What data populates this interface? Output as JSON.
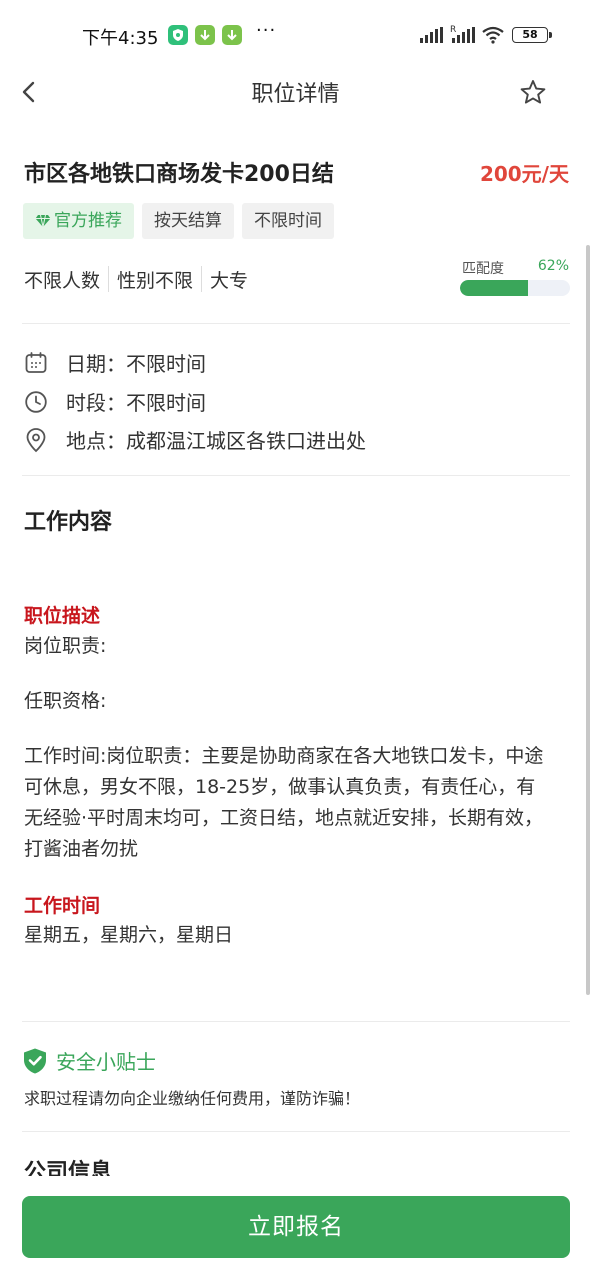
{
  "status_bar": {
    "time": "下午4:35",
    "dots": "···",
    "battery": "58"
  },
  "nav": {
    "title": "职位详情"
  },
  "job": {
    "title": "市区各地铁口商场发卡200日结",
    "salary": "200元/天",
    "tags": [
      "官方推荐",
      "按天结算",
      "不限时间"
    ],
    "attributes": [
      "不限人数",
      "性别不限",
      "大专"
    ],
    "match": {
      "label": "匹配度",
      "value_text": "62%",
      "value": 0.62
    }
  },
  "info": {
    "date": "日期：不限时间",
    "period": "时段：不限时间",
    "location": "地点：成都温江城区各铁口进出处"
  },
  "work_content": {
    "title": "工作内容",
    "desc_title": "职位描述",
    "duties": "岗位职责:",
    "qualifications": "任职资格:",
    "worktime_para": "工作时间:岗位职责：主要是协助商家在各大地铁口发卡，中途可休息，男女不限，18-25岁，做事认真负责，有责任心，有无经验·平时周末均可，工资日结，地点就近安排，长期有效，打酱油者勿扰",
    "time_title": "工作时间",
    "days": "星期五，星期六，星期日"
  },
  "safety": {
    "title": "安全小贴士",
    "text": "求职过程请勿向企业缴纳任何费用，谨防诈骗！"
  },
  "company": {
    "title": "公司信息"
  },
  "apply_button": "立即报名",
  "colors": {
    "accent": "#3aa65a",
    "salary": "#e0463b",
    "section_red": "#c8161d"
  }
}
